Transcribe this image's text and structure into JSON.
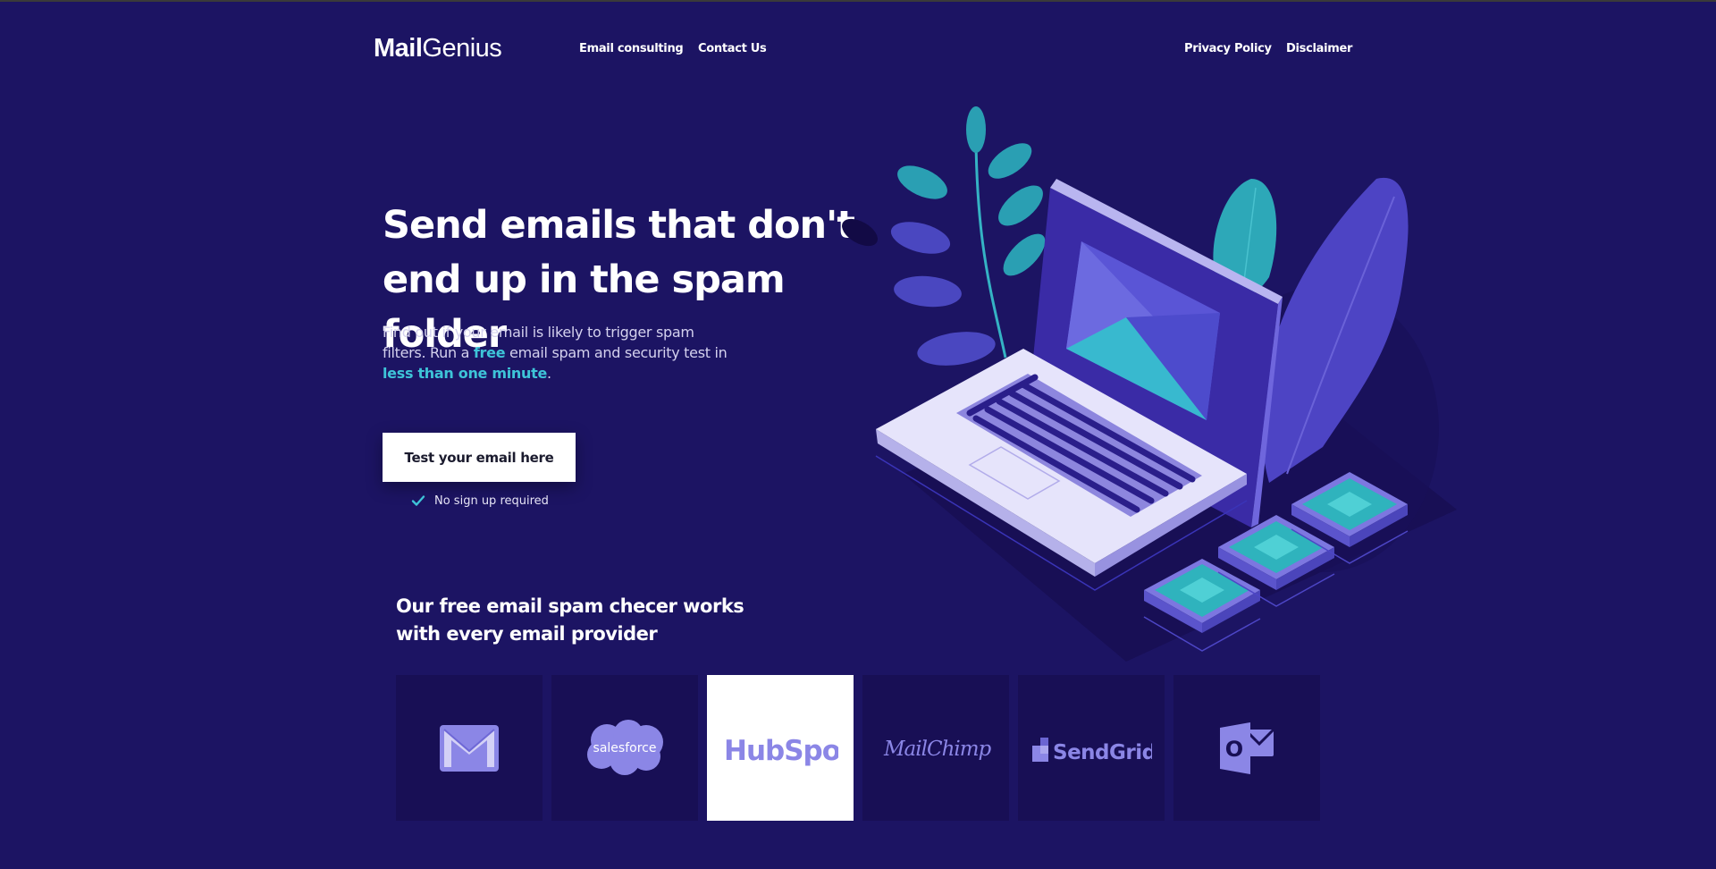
{
  "nav": {
    "logo_bold": "Mail",
    "logo_light": "Genius",
    "links": [
      "Email consulting",
      "Contact Us",
      "Privacy Policy",
      "Disclaimer"
    ]
  },
  "hero": {
    "title_line1": "Send emails that don't",
    "title_line2": "end up in the spam folder",
    "desc_part1": "Find out if your email is likely to trigger spam filters. Run a ",
    "desc_free": "free",
    "desc_part2": " email spam and security test in ",
    "desc_time": "less than one minute",
    "desc_end": ".",
    "cta_label": "Test your email here",
    "no_signup": "No sign up required"
  },
  "providers": {
    "title_line1": "Our free email spam checer works",
    "title_line2": "with every email provider",
    "items": [
      {
        "name": "gmail-icon",
        "label": ""
      },
      {
        "name": "salesforce-logo",
        "label": "salesforce"
      },
      {
        "name": "hubspot-logo",
        "label": "HubSpot"
      },
      {
        "name": "mailchimp-logo",
        "label": "MailChimp"
      },
      {
        "name": "sendgrid-logo",
        "label": "SendGrid"
      },
      {
        "name": "outlook-icon",
        "label": "O"
      }
    ]
  },
  "colors": {
    "background": "#1c1463",
    "accent": "#3ec4d8",
    "tile": "#180f55",
    "logo_purple": "#8b86e6"
  }
}
